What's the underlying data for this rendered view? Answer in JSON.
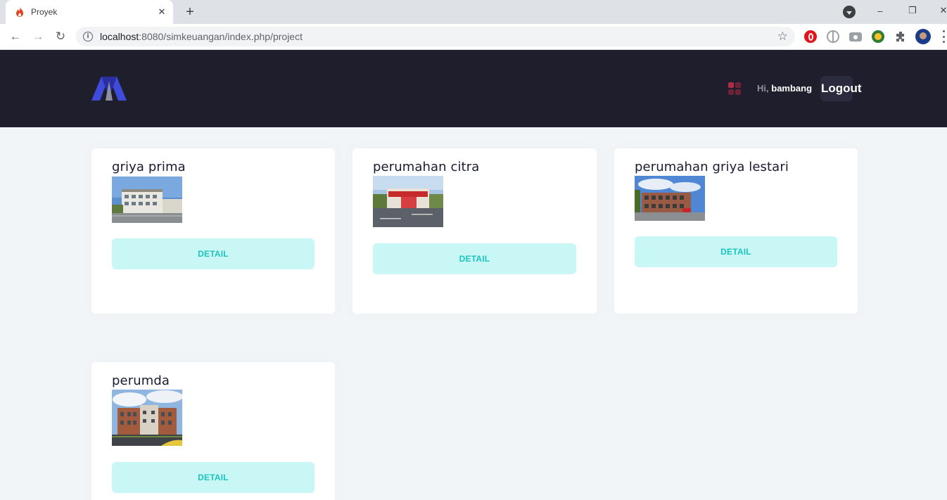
{
  "browser": {
    "tab_title": "Proyek",
    "tab_close": "✕",
    "new_tab": "+",
    "url_host": "localhost",
    "url_path": ":8080/simkeuangan/index.php/project",
    "window_controls": [
      "–",
      "❐",
      "✕"
    ],
    "nav": {
      "back": "←",
      "forward": "→",
      "reload": "↻"
    },
    "star": "☆"
  },
  "header": {
    "greeting_prefix": "Hi,",
    "username": "bambang",
    "logout_label": "Logout"
  },
  "projects": [
    {
      "name": "griya prima",
      "button_label": "DETAIL"
    },
    {
      "name": "perumahan citra",
      "button_label": "DETAIL"
    },
    {
      "name": "perumahan griya lestari",
      "button_label": "DETAIL"
    },
    {
      "name": "perumda",
      "button_label": "DETAIL"
    }
  ],
  "colors": {
    "header_bg": "#1e1e2d",
    "page_bg": "#f2f5f8",
    "button_bg": "#c9f7f5",
    "button_text": "#1bc5bd",
    "logo_blue": "#3f4bdb",
    "apps_icon": "#b02a4a"
  }
}
